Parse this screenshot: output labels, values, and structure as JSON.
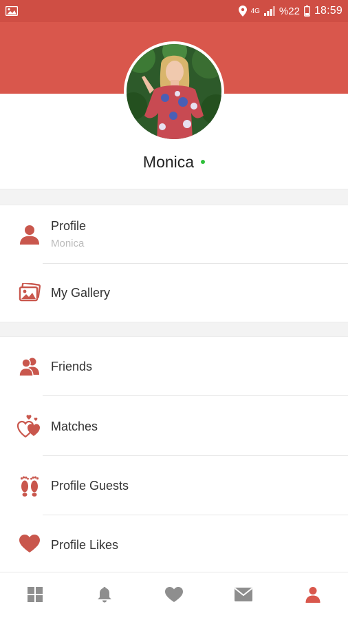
{
  "status_bar": {
    "notification_icon": "image-notification-icon",
    "network": "4G",
    "battery": "%22",
    "time": "18:59"
  },
  "profile": {
    "name": "Monica",
    "online": true,
    "avatar_icon": "profile-photo"
  },
  "menu": {
    "profile": {
      "label": "Profile",
      "sub": "Monica",
      "icon": "user-icon"
    },
    "gallery": {
      "label": "My Gallery",
      "icon": "gallery-icon"
    },
    "friends": {
      "label": "Friends",
      "icon": "friends-icon"
    },
    "matches": {
      "label": "Matches",
      "icon": "hearts-icon"
    },
    "guests": {
      "label": "Profile Guests",
      "icon": "footprints-icon"
    },
    "likes": {
      "label": "Profile Likes",
      "icon": "heart-icon"
    }
  },
  "bottom_nav": [
    {
      "name": "dashboard",
      "icon": "grid-icon",
      "active": false
    },
    {
      "name": "notifications",
      "icon": "bell-icon",
      "active": false
    },
    {
      "name": "likes",
      "icon": "heart-icon",
      "active": false
    },
    {
      "name": "messages",
      "icon": "envelope-icon",
      "active": false
    },
    {
      "name": "profile",
      "icon": "user-icon",
      "active": true
    }
  ],
  "colors": {
    "brand": "#d9574c",
    "status_bar": "#cf4e44",
    "icon": "#c9574d",
    "inactive_icon": "#8e8e8e",
    "online": "#2fbf3a"
  }
}
